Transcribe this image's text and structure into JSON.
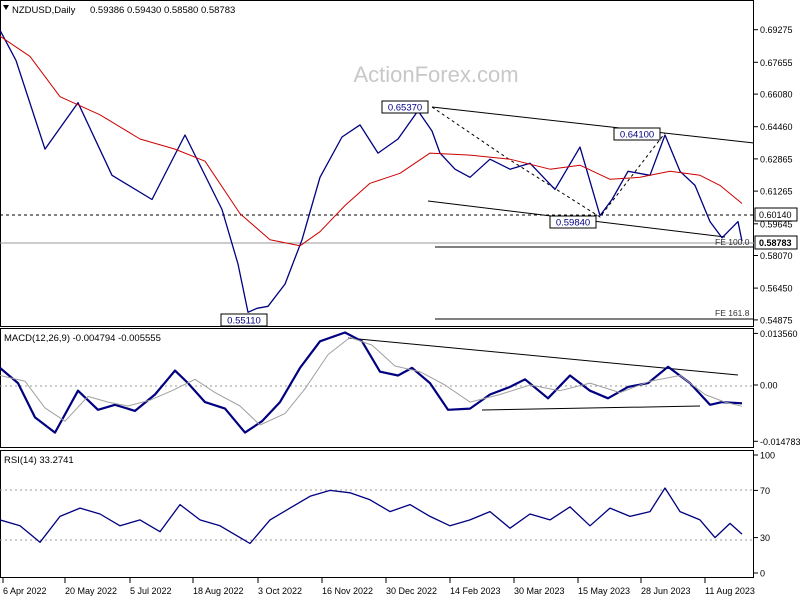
{
  "watermark": "ActionForex.com",
  "chart_data": [
    {
      "panel": "price",
      "type": "line",
      "header": {
        "symbol": "NZDUSD,Daily",
        "ohlc": "0.59386 0.59430 0.58580 0.58783"
      },
      "y_ticks": [
        "0.69275",
        "0.67655",
        "0.66080",
        "0.64460",
        "0.62865",
        "0.61265",
        "0.59645",
        "0.58070",
        "0.56450",
        "0.54875"
      ],
      "ylim": [
        0.5472,
        0.7055
      ],
      "series": [
        {
          "color": "#000080",
          "x": [
            0,
            16,
            45,
            78,
            112,
            152,
            185,
            222,
            238,
            248,
            257,
            268,
            285,
            302,
            320,
            342,
            360,
            378,
            398,
            418,
            432,
            440,
            455,
            470,
            490,
            510,
            530,
            555,
            580,
            600,
            612,
            628,
            650,
            665,
            680,
            695,
            710,
            722,
            738,
            742
          ],
          "values": [
            0.6925,
            0.6775,
            0.6335,
            0.6565,
            0.6205,
            0.6085,
            0.6405,
            0.6035,
            0.5765,
            0.5525,
            0.5545,
            0.5555,
            0.5665,
            0.5885,
            0.6195,
            0.6395,
            0.6455,
            0.6315,
            0.6385,
            0.6525,
            0.6425,
            0.6315,
            0.6235,
            0.6195,
            0.6285,
            0.6235,
            0.6265,
            0.6135,
            0.6345,
            0.6005,
            0.6085,
            0.6225,
            0.6205,
            0.6405,
            0.6225,
            0.6155,
            0.5975,
            0.5895,
            0.5975,
            0.5878
          ]
        },
        {
          "color": "#cc0000",
          "x": [
            0,
            30,
            60,
            100,
            140,
            175,
            205,
            240,
            270,
            300,
            320,
            345,
            370,
            400,
            430,
            470,
            510,
            550,
            580,
            610,
            640,
            670,
            700,
            720,
            742
          ],
          "values": [
            0.6895,
            0.6795,
            0.6595,
            0.6505,
            0.6385,
            0.6335,
            0.6275,
            0.6015,
            0.5885,
            0.5855,
            0.5925,
            0.6055,
            0.6165,
            0.6215,
            0.6315,
            0.6305,
            0.6285,
            0.6235,
            0.6255,
            0.6185,
            0.6195,
            0.6225,
            0.6205,
            0.6155,
            0.6065
          ]
        }
      ],
      "annotations": [
        "0.65370",
        "0.64100",
        "0.59840",
        "0.55110",
        "FE 100.0",
        "FE 161.8"
      ],
      "right_labels": [
        "0.60140",
        "0.58783"
      ]
    },
    {
      "panel": "macd",
      "type": "line",
      "header": "MACD(12,26,9) -0.004794 -0.005555",
      "y_ticks": [
        "0.013560",
        "0.00",
        "-0.014783"
      ],
      "ylim": [
        -0.0155,
        0.0142
      ],
      "series": [
        {
          "color": "#000080",
          "x": [
            0,
            18,
            35,
            55,
            78,
            98,
            115,
            135,
            155,
            175,
            188,
            205,
            225,
            245,
            262,
            280,
            300,
            320,
            345,
            362,
            380,
            398,
            412,
            430,
            448,
            470,
            490,
            510,
            525,
            548,
            570,
            590,
            608,
            628,
            648,
            668,
            690,
            710,
            722,
            742
          ],
          "values": [
            0.0045,
            0.0005,
            -0.0085,
            -0.0125,
            -0.0015,
            -0.0065,
            -0.0052,
            -0.0068,
            -0.0025,
            0.0038,
            0.0005,
            -0.0045,
            -0.0062,
            -0.0125,
            -0.0095,
            -0.0045,
            0.0045,
            0.0115,
            0.0138,
            0.0115,
            0.0035,
            0.0025,
            0.0045,
            0.0005,
            -0.0065,
            -0.0062,
            -0.0025,
            -0.0005,
            0.0015,
            -0.0035,
            0.0025,
            -0.0015,
            -0.0035,
            -0.0005,
            0.0005,
            0.0048,
            0.0005,
            -0.0052,
            -0.0045,
            -0.0048
          ]
        },
        {
          "color": "#a0a0a0",
          "x": [
            0,
            25,
            45,
            65,
            88,
            108,
            128,
            150,
            172,
            195,
            215,
            240,
            260,
            285,
            305,
            328,
            350,
            372,
            395,
            420,
            445,
            470,
            500,
            530,
            560,
            590,
            620,
            650,
            680,
            705,
            725,
            742
          ],
          "values": [
            0.0025,
            0.001,
            -0.006,
            -0.0095,
            -0.003,
            -0.0045,
            -0.0055,
            -0.004,
            -0.0015,
            0.0015,
            -0.002,
            -0.0055,
            -0.0105,
            -0.0075,
            -0.001,
            0.008,
            0.0125,
            0.0105,
            0.005,
            0.0035,
            0.0,
            -0.0045,
            -0.0025,
            0.0,
            -0.0015,
            0.0005,
            -0.002,
            0.001,
            0.0025,
            -0.0025,
            -0.0045,
            -0.0056
          ]
        }
      ]
    },
    {
      "panel": "rsi",
      "type": "line",
      "header": "RSI(14) 33.2741",
      "y_ticks": [
        "100",
        "70",
        "30",
        "0"
      ],
      "ylim": [
        0,
        100
      ],
      "series": [
        {
          "color": "#000080",
          "x": [
            0,
            20,
            40,
            60,
            80,
            100,
            120,
            140,
            160,
            180,
            200,
            220,
            240,
            250,
            270,
            290,
            310,
            330,
            350,
            370,
            390,
            410,
            430,
            450,
            470,
            490,
            510,
            530,
            550,
            570,
            590,
            610,
            630,
            650,
            665,
            680,
            700,
            715,
            730,
            742
          ],
          "values": [
            45,
            40,
            26,
            48,
            55,
            50,
            40,
            45,
            35,
            58,
            45,
            40,
            30,
            25,
            45,
            55,
            65,
            70,
            68,
            62,
            52,
            58,
            48,
            40,
            45,
            52,
            38,
            50,
            45,
            56,
            40,
            55,
            48,
            52,
            72,
            52,
            45,
            30,
            42,
            33
          ]
        }
      ]
    }
  ],
  "x_ticks": [
    "6 Apr 2022",
    "20 May 2022",
    "5 Jul 2022",
    "18 Aug 2022",
    "3 Oct 2022",
    "16 Nov 2022",
    "30 Dec 2022",
    "14 Feb 2023",
    "30 Mar 2023",
    "15 May 2023",
    "28 Jun 2023",
    "11 Aug 2023"
  ],
  "colors": {
    "price": "#000080",
    "ma": "#cc0000",
    "macd_signal": "#a0a0a0",
    "trendline": "#000000",
    "grid": "#999999"
  }
}
